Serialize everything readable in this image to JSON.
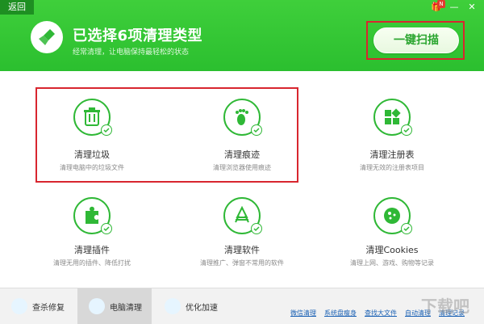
{
  "header": {
    "back_label": "返回",
    "title": "已选择6项清理类型",
    "subtitle": "经常清理，让电脑保持最轻松的状态",
    "scan_button_label": "一键扫描",
    "window_buttons": [
      "gift-icon",
      "minimize-icon",
      "close-icon"
    ],
    "badge_text": "N"
  },
  "items": [
    {
      "title": "清理垃圾",
      "desc": "清理电脑中的垃圾文件",
      "icon": "trash-icon"
    },
    {
      "title": "清理痕迹",
      "desc": "清理浏览器使用痕迹",
      "icon": "footprint-icon"
    },
    {
      "title": "清理注册表",
      "desc": "清理无效的注册表项目",
      "icon": "registry-icon"
    },
    {
      "title": "清理插件",
      "desc": "清理无用的插件、降低打扰",
      "icon": "puzzle-icon"
    },
    {
      "title": "清理软件",
      "desc": "清理推广、弹窗不常用的软件",
      "icon": "app-icon"
    },
    {
      "title": "清理Cookies",
      "desc": "清理上网、游戏、购物等记录",
      "icon": "cookie-icon"
    }
  ],
  "bottom": {
    "tabs": [
      {
        "label": "查杀修复",
        "icon": "shield-icon"
      },
      {
        "label": "电脑清理",
        "icon": "broom-icon"
      },
      {
        "label": "优化加速",
        "icon": "rocket-icon"
      }
    ],
    "links": [
      "微信清理",
      "系统盘瘦身",
      "查找大文件",
      "自动清理",
      "清理记录"
    ],
    "watermark": "下载吧"
  },
  "colors": {
    "header_green": "#2bbf2f",
    "accent_green": "#2fb836",
    "highlight_red": "#d8262f"
  }
}
